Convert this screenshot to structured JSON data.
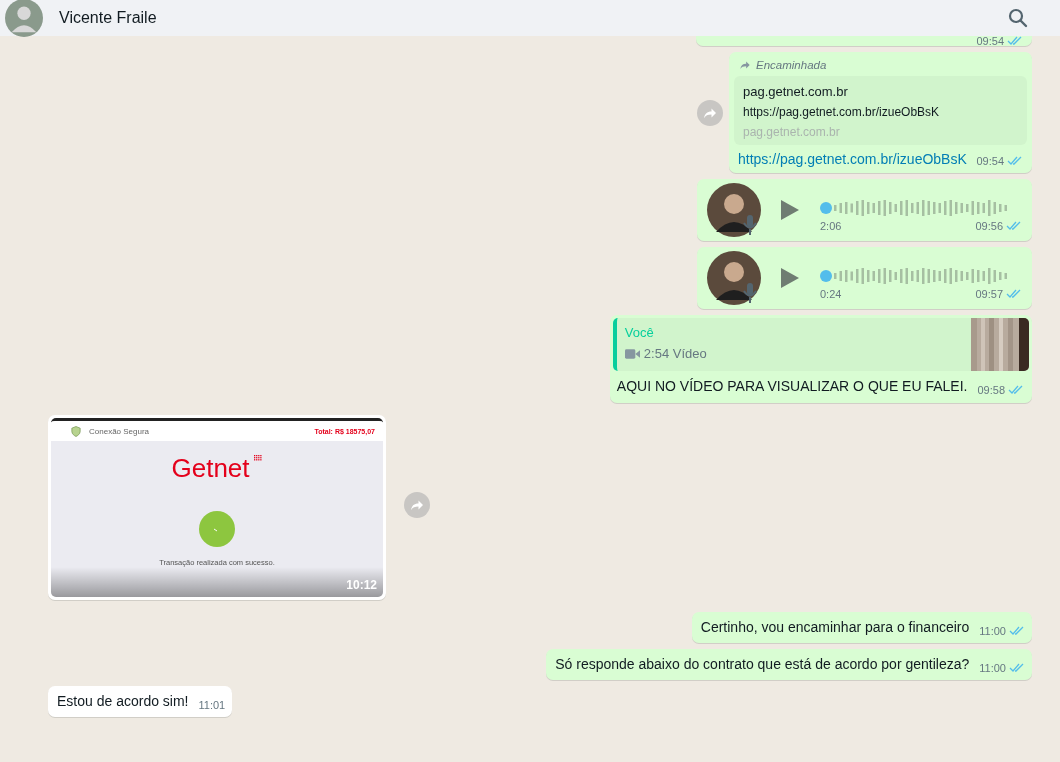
{
  "header": {
    "contact_name": "Vicente Fraile"
  },
  "messages": [
    {
      "kind": "fragment",
      "outgoing": true,
      "time": "09:54",
      "read": true
    },
    {
      "kind": "link",
      "outgoing": true,
      "forwarded_label": "Encaminhada",
      "preview": {
        "title": "pag.getnet.com.br",
        "url": "https://pag.getnet.com.br/izueObBsK",
        "domain": "pag.getnet.com.br"
      },
      "text": "https://pag.getnet.com.br/izueObBsK",
      "time": "09:54",
      "read": true
    },
    {
      "kind": "voice",
      "outgoing": true,
      "duration": "2:06",
      "time": "09:56",
      "read": true
    },
    {
      "kind": "voice",
      "outgoing": true,
      "duration": "0:24",
      "time": "09:57",
      "read": true
    },
    {
      "kind": "reply",
      "outgoing": true,
      "quote": {
        "author": "Você",
        "media": "2:54 Vídeo"
      },
      "text": "AQUI NO VÍDEO PARA VISUALIZAR O QUE EU FALEI.",
      "time": "09:58",
      "read": true
    },
    {
      "kind": "screenshot",
      "outgoing": false,
      "screen": {
        "secure_label": "Conexão Segura",
        "total": "Total: R$ 18575,07",
        "brand": "Getnet",
        "status": "Transação realizada com sucesso."
      },
      "time": "10:12"
    },
    {
      "kind": "text",
      "outgoing": true,
      "text": "Certinho, vou encaminhar para o financeiro",
      "time": "11:00",
      "read": true
    },
    {
      "kind": "text",
      "outgoing": true,
      "text": "Só responde abaixo do contrato que está de acordo por gentileza?",
      "time": "11:00",
      "read": true
    },
    {
      "kind": "text",
      "outgoing": false,
      "text": "Estou de acordo sim!",
      "time": "11:01"
    }
  ]
}
